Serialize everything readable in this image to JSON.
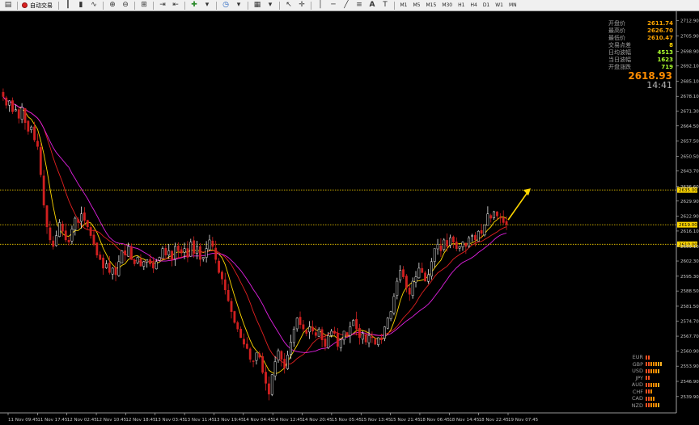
{
  "toolbar": {
    "auto_trading_label": "自动交易",
    "timeframes": [
      "M1",
      "M5",
      "M15",
      "M30",
      "H1",
      "H4",
      "D1",
      "W1",
      "MN"
    ]
  },
  "info_panel": [
    {
      "label": "开盘价",
      "value": "2611.74",
      "color": "#ffa500"
    },
    {
      "label": "最高价",
      "value": "2626.70",
      "color": "#ffa500"
    },
    {
      "label": "最低价",
      "value": "2610.47",
      "color": "#ffa500"
    },
    {
      "label": "交易点差",
      "value": "8",
      "color": "#ffd700"
    },
    {
      "label": "日均波幅",
      "value": "4513",
      "color": "#adff2f"
    },
    {
      "label": "当日波幅",
      "value": "1623",
      "color": "#adff2f"
    },
    {
      "label": "开盘涨跌",
      "value": "719",
      "color": "#adff2f"
    }
  ],
  "current_price": "2618.93",
  "clock": "14:41",
  "currency_strength": [
    {
      "label": "EUR",
      "level": 2
    },
    {
      "label": "GBP",
      "level": 7
    },
    {
      "label": "USD",
      "level": 6
    },
    {
      "label": "JPY",
      "level": 2
    },
    {
      "label": "AUD",
      "level": 6
    },
    {
      "label": "CHF",
      "level": 3
    },
    {
      "label": "CAD",
      "level": 4
    },
    {
      "label": "NZD",
      "level": 6
    }
  ],
  "chart_data": {
    "type": "candlestick",
    "symbol_price_range": [
      2535.0,
      2715.0
    ],
    "price_ticks": [
      "2712.90",
      "2705.90",
      "2698.90",
      "2692.10",
      "2685.10",
      "2678.10",
      "2671.30",
      "2664.50",
      "2657.50",
      "2650.50",
      "2643.70",
      "2636.60",
      "2629.90",
      "2622.90",
      "2616.10",
      "2609.10",
      "2602.30",
      "2595.30",
      "2588.50",
      "2581.50",
      "2574.70",
      "2567.70",
      "2560.90",
      "2553.90",
      "2546.90",
      "2539.90"
    ],
    "horizontal_levels": [
      {
        "value": "2635.00",
        "color": "#ffd700",
        "style": "dotted"
      },
      {
        "value": "2619.00",
        "color": "#ffd700",
        "style": "dotted"
      },
      {
        "value": "2610.00",
        "color": "#ffd700",
        "style": "dotted"
      }
    ],
    "time_labels": [
      "11 Nov 09:45",
      "11 Nov 17:45",
      "12 Nov 02:45",
      "12 Nov 10:45",
      "12 Nov 18:45",
      "13 Nov 03:45",
      "13 Nov 11:45",
      "13 Nov 19:45",
      "14 Nov 04:45",
      "14 Nov 12:45",
      "14 Nov 20:45",
      "15 Nov 05:45",
      "15 Nov 13:45",
      "15 Nov 21:45",
      "18 Nov 06:45",
      "18 Nov 14:45",
      "18 Nov 22:45",
      "19 Nov 07:45"
    ],
    "closes": [
      2678,
      2674,
      2676,
      2671,
      2672,
      2668,
      2673,
      2666,
      2662,
      2664,
      2658,
      2655,
      2642,
      2628,
      2618,
      2612,
      2609,
      2614,
      2620,
      2616,
      2612,
      2611,
      2617,
      2622,
      2620,
      2624,
      2621,
      2618,
      2614,
      2610,
      2605,
      2603,
      2599,
      2601,
      2597,
      2599,
      2596,
      2602,
      2607,
      2605,
      2609,
      2603,
      2601,
      2604,
      2600,
      2602,
      2603,
      2601,
      2599,
      2602,
      2604,
      2608,
      2605,
      2607,
      2603,
      2609,
      2607,
      2606,
      2608,
      2604,
      2611,
      2606,
      2609,
      2603,
      2604,
      2608,
      2612,
      2609,
      2603,
      2597,
      2594,
      2589,
      2584,
      2579,
      2574,
      2571,
      2567,
      2564,
      2562,
      2557,
      2556,
      2560,
      2558,
      2551,
      2546,
      2541,
      2550,
      2556,
      2561,
      2557,
      2553,
      2559,
      2565,
      2571,
      2576,
      2573,
      2571,
      2569,
      2572,
      2570,
      2568,
      2571,
      2566,
      2563,
      2568,
      2570,
      2569,
      2563,
      2566,
      2570,
      2568,
      2572,
      2575,
      2571,
      2567,
      2569,
      2565,
      2568,
      2567,
      2564,
      2567,
      2566,
      2572,
      2576,
      2579,
      2586,
      2593,
      2598,
      2595,
      2590,
      2587,
      2593,
      2595,
      2599,
      2597,
      2593,
      2596,
      2602,
      2608,
      2610,
      2607,
      2612,
      2609,
      2613,
      2611,
      2608,
      2609,
      2611,
      2609,
      2613,
      2614,
      2612,
      2616,
      2615,
      2619,
      2624,
      2622,
      2625,
      2623,
      2622,
      2620,
      2619
    ],
    "ma_fast_color": "#ffd700",
    "ma_mid_color": "#e02020",
    "ma_slow_color": "#e020e0",
    "arrow_target_price": "2635.00"
  }
}
